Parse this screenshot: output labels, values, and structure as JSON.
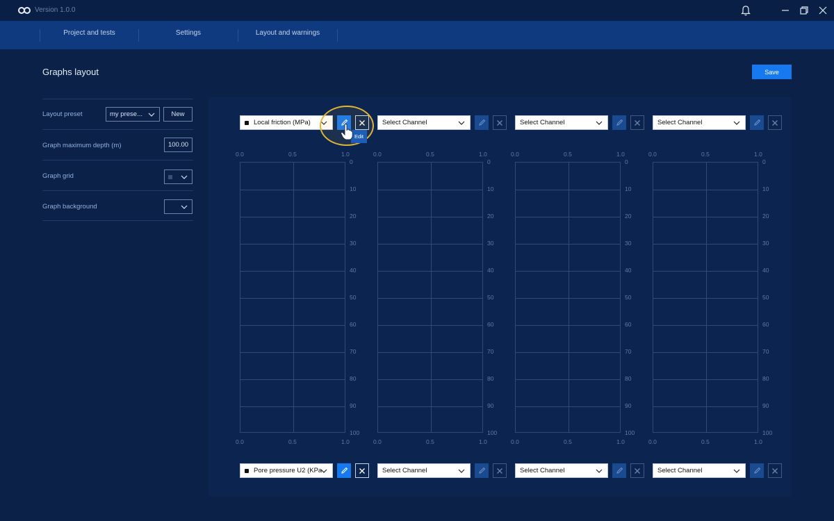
{
  "app": {
    "version": "Version 1.0.0"
  },
  "nav": {
    "tabs": [
      {
        "label": "Project and tests"
      },
      {
        "label": "Settings"
      },
      {
        "label": "Layout and warnings"
      }
    ]
  },
  "page": {
    "title": "Graphs layout",
    "save_label": "Save"
  },
  "settings": {
    "layout_preset": {
      "label": "Layout preset",
      "value": "my prese...",
      "new_label": "New"
    },
    "max_depth": {
      "label": "Graph maximum depth (m)",
      "value": "100.00"
    },
    "grid": {
      "label": "Graph grid"
    },
    "background": {
      "label": "Graph background"
    }
  },
  "top_channels": [
    {
      "label": "Local friction (MPa)",
      "active": true
    },
    {
      "label": "Select Channel",
      "active": false
    },
    {
      "label": "Select Channel",
      "active": false
    },
    {
      "label": "Select Channel",
      "active": false
    }
  ],
  "bottom_channels": [
    {
      "label": "Pore pressure U2 (KPa",
      "active": true
    },
    {
      "label": "Select Channel",
      "active": false
    },
    {
      "label": "Select Channel",
      "active": false
    },
    {
      "label": "Select Channel",
      "active": false
    }
  ],
  "axis": {
    "x_ticks": [
      "0.0",
      "0.5",
      "1.0"
    ],
    "y_ticks": [
      "0",
      "10",
      "20",
      "30",
      "40",
      "50",
      "60",
      "70",
      "80",
      "90",
      "100"
    ]
  },
  "tooltip": {
    "edit": "Edit"
  },
  "colors": {
    "accent": "#1679f0",
    "background": "#0b2147",
    "nav": "#0f3a80"
  }
}
